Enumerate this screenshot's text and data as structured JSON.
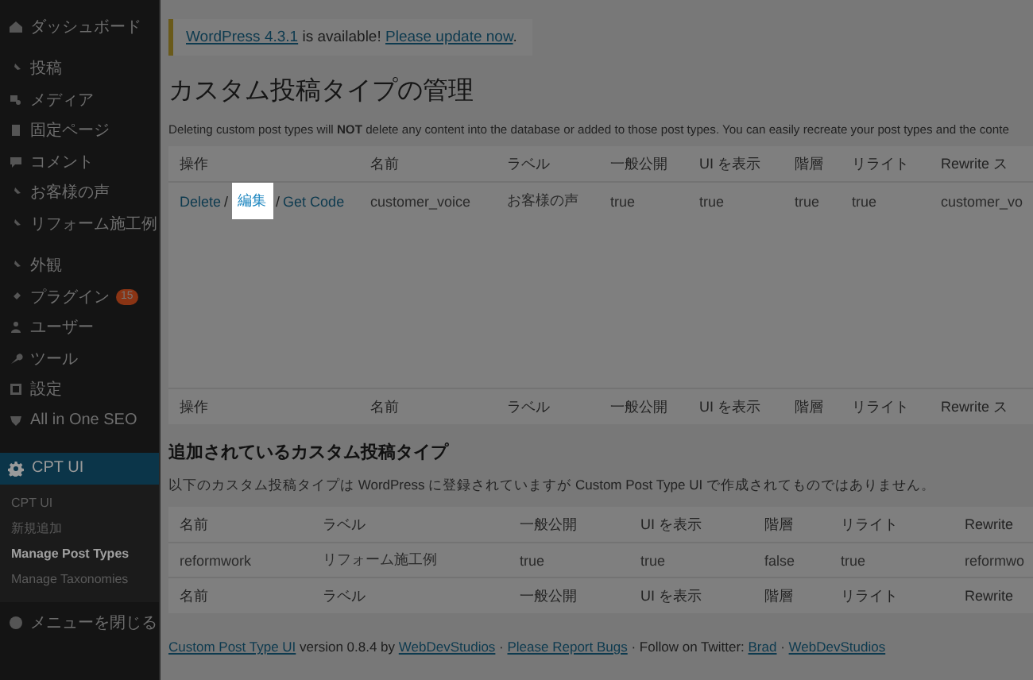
{
  "sidebar": {
    "groups": [
      {
        "items": [
          {
            "label": "ダッシュボード",
            "selected": false
          }
        ]
      },
      {
        "items": [
          {
            "label": "投稿",
            "selected": false
          },
          {
            "label": "メディア",
            "selected": false
          },
          {
            "label": "固定ページ",
            "selected": false
          },
          {
            "label": "コメント",
            "selected": false
          },
          {
            "label": "お客様の声",
            "selected": false
          },
          {
            "label": "リフォーム施工例",
            "selected": false
          }
        ]
      },
      {
        "items": [
          {
            "label": "外観",
            "selected": false
          },
          {
            "label": "プラグイン",
            "badge": "15",
            "selected": false
          },
          {
            "label": "ユーザー",
            "selected": false
          },
          {
            "label": "ツール",
            "selected": false
          },
          {
            "label": "設定",
            "selected": false
          },
          {
            "label": "All in One SEO",
            "selected": false
          }
        ]
      }
    ],
    "active": {
      "label": "CPT UI",
      "selected": true,
      "submenu": [
        {
          "label": "CPT UI",
          "selected": false
        },
        {
          "label": "新規追加",
          "selected": false
        },
        {
          "label": "Manage Post Types",
          "selected": true
        },
        {
          "label": "Manage Taxonomies",
          "selected": false
        }
      ]
    },
    "collapse": {
      "label": "メニューを閉じる"
    }
  },
  "notice": [
    {
      "kind": "link",
      "text": "WordPress 4.3.1"
    },
    {
      "kind": "text",
      "text": " is available! "
    },
    {
      "kind": "link",
      "text": "Please update now"
    },
    {
      "kind": "text",
      "text": "."
    }
  ],
  "page_title": "カスタム投稿タイプの管理",
  "description": "Deleting custom post types will **NOT** delete any content into the database or added to those post types. You can easily recreate your post types and the conte",
  "post_types_table": {
    "columns": [
      "操作",
      "名前",
      "ラベル",
      "一般公開",
      "UI を表示",
      "階層",
      "リライト",
      "Rewrite ス"
    ],
    "rows": [
      {
        "cells": [
          {
            "actions": [
              {
                "label": "Delete",
                "highlighted": false
              },
              {
                "label": "編集",
                "highlighted": true
              },
              {
                "label": "Get Code",
                "highlighted": false
              }
            ],
            "separator": "/"
          },
          "customer_voice",
          "お客様の声",
          "true",
          "true",
          "true",
          "true",
          "customer_vo"
        ]
      }
    ],
    "footer_columns": [
      "操作",
      "名前",
      "ラベル",
      "一般公開",
      "UI を表示",
      "階層",
      "リライト",
      "Rewrite ス"
    ]
  },
  "other_section": {
    "title": "追加されているカスタム投稿タイプ",
    "description": "以下のカスタム投稿タイプは WordPress に登録されていますが Custom Post Type UI で作成されてものではありません。",
    "columns": [
      "名前",
      "ラベル",
      "一般公開",
      "UI を表示",
      "階層",
      "リライト",
      "Rewrite"
    ],
    "rows": [
      {
        "cells": [
          "reformwork",
          "リフォーム施工例",
          "true",
          "true",
          "false",
          "true",
          "reformwo"
        ]
      }
    ],
    "footer_columns": [
      "名前",
      "ラベル",
      "一般公開",
      "UI を表示",
      "階層",
      "リライト",
      "Rewrite"
    ]
  },
  "footer": [
    {
      "kind": "link",
      "text": "Custom Post Type UI"
    },
    {
      "kind": "text",
      "text": " version 0.8.4 by "
    },
    {
      "kind": "link",
      "text": "WebDevStudios"
    },
    {
      "kind": "text",
      "text": " · "
    },
    {
      "kind": "link",
      "text": "Please Report Bugs"
    },
    {
      "kind": "text",
      "text": " · Follow on Twitter: "
    },
    {
      "kind": "link",
      "text": "Brad"
    },
    {
      "kind": "text",
      "text": " · "
    },
    {
      "kind": "link",
      "text": "WebDevStudios"
    }
  ]
}
